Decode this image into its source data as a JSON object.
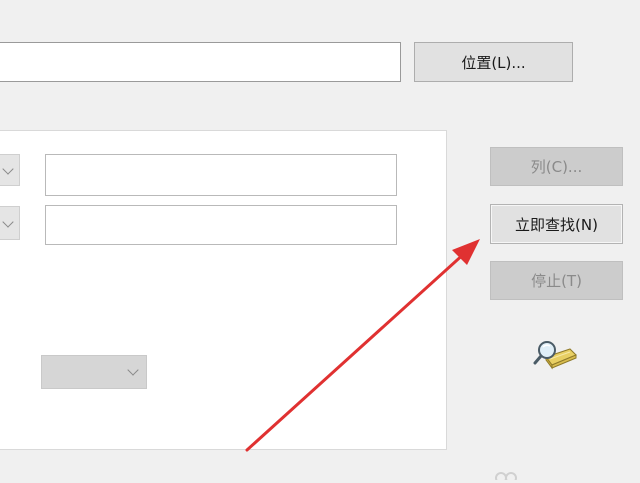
{
  "location": {
    "path_value": "",
    "browse_label": "位置(L)..."
  },
  "actions": {
    "columns_label": "列(C)...",
    "find_now_label": "立即查找(N)",
    "stop_label": "停止(T)"
  },
  "criteria": {
    "row1_value": "",
    "row2_value": "",
    "condition_value": ""
  },
  "icons": {
    "search_animation": "magnifier-over-book-icon",
    "annotation": "red-pointer-arrow"
  },
  "colors": {
    "arrow": "#e03131"
  }
}
